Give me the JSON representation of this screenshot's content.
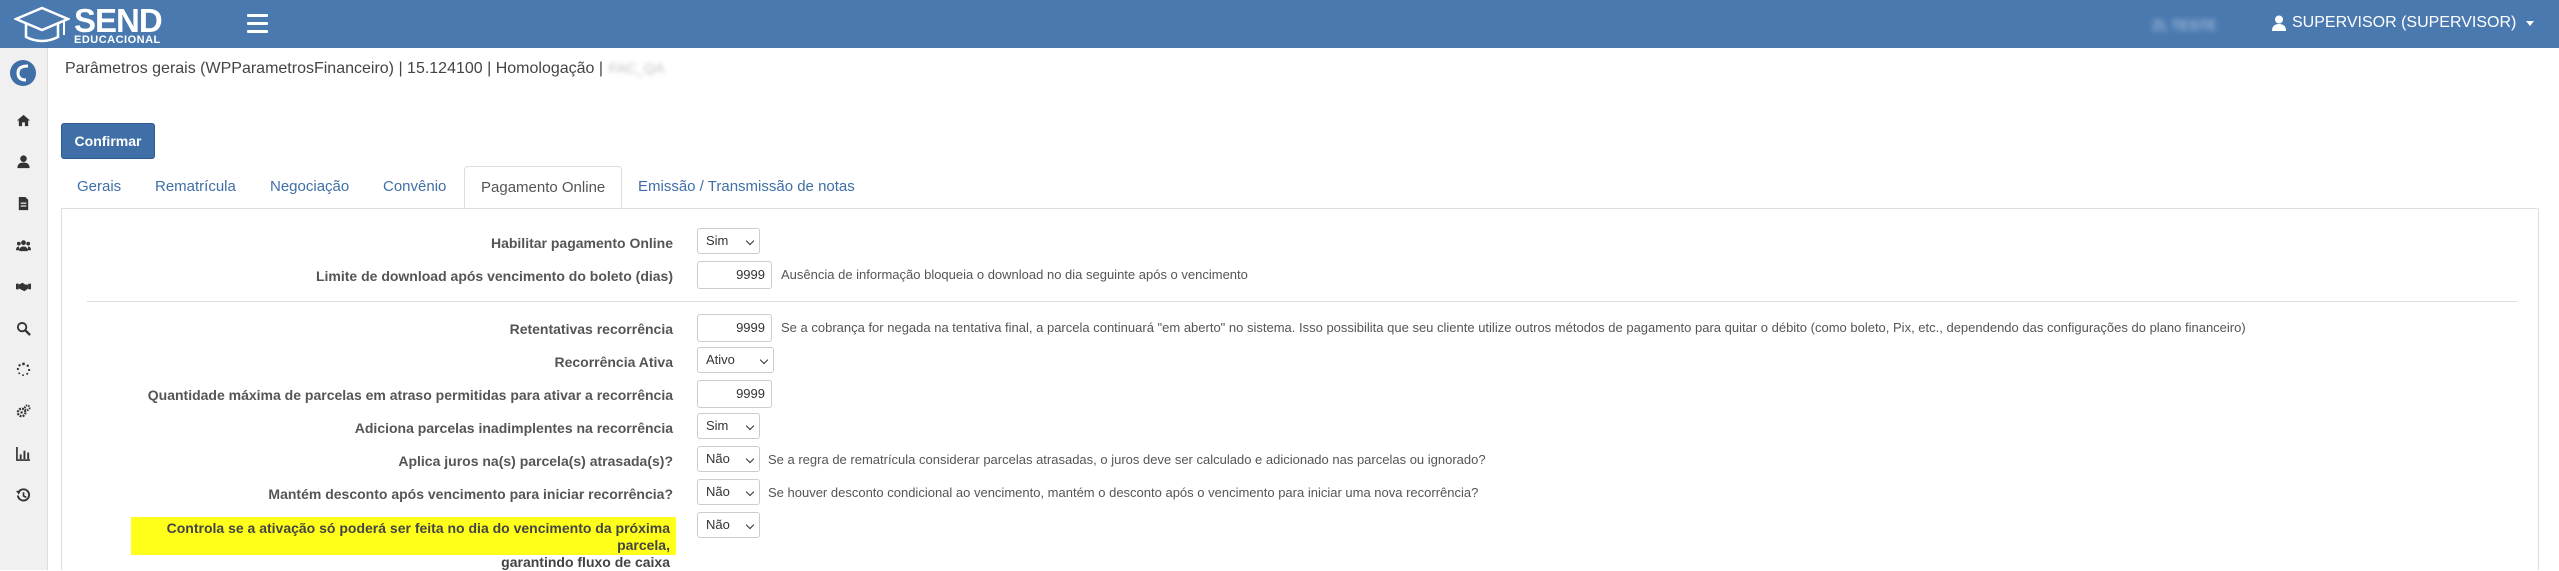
{
  "header": {
    "logo_main": "SEND",
    "logo_sub": "EDUCACIONAL",
    "blurred_context": "ZL TESTE",
    "user_label": "SUPERVISOR (SUPERVISOR)"
  },
  "page": {
    "breadcrumb": "Parâmetros gerais (WPParametrosFinanceiro) | 15.124100 | Homologação |",
    "breadcrumb_blurred": "FAC_QA",
    "confirm_label": "Confirmar"
  },
  "tabs": [
    {
      "label": "Gerais"
    },
    {
      "label": "Rematrícula"
    },
    {
      "label": "Negociação"
    },
    {
      "label": "Convênio"
    },
    {
      "label": "Pagamento Online"
    },
    {
      "label": "Emissão / Transmissão de notas"
    }
  ],
  "form": {
    "habilitar": {
      "label": "Habilitar pagamento Online",
      "value": "Sim"
    },
    "limite": {
      "label": "Limite de download após vencimento do boleto (dias)",
      "value": "9999",
      "hint": "Ausência de informação bloqueia o download no dia seguinte após o vencimento"
    },
    "retentativas": {
      "label": "Retentativas recorrência",
      "value": "9999",
      "hint": "Se a cobrança for negada na tentativa final, a parcela continuará \"em aberto\" no sistema. Isso possibilita que seu cliente utilize outros métodos de pagamento para quitar o débito (como boleto, Pix, etc., dependendo das configurações do plano financeiro)"
    },
    "recorrencia_ativa": {
      "label": "Recorrência Ativa",
      "value": "Ativo"
    },
    "qtd_max": {
      "label": "Quantidade máxima de parcelas em atraso permitidas para ativar a recorrência",
      "value": "9999"
    },
    "adiciona": {
      "label": "Adiciona parcelas inadimplentes na recorrência",
      "value": "Sim"
    },
    "juros": {
      "label": "Aplica juros na(s) parcela(s) atrasada(s)?",
      "value": "Não",
      "hint": "Se a regra de rematrícula considerar parcelas atrasadas, o juros deve ser calculado e adicionado nas parcelas ou ignorado?"
    },
    "desconto": {
      "label": "Mantém desconto após vencimento para iniciar recorrência?",
      "value": "Não",
      "hint": "Se houver desconto condicional ao vencimento, mantém o desconto após o vencimento para iniciar uma nova recorrência?"
    },
    "controla": {
      "label_line1": "Controla se a ativação só poderá ser feita no dia do vencimento da próxima parcela,",
      "label_line2": "garantindo fluxo de caixa",
      "value": "Não"
    }
  },
  "colors": {
    "topbar": "#4a79b0",
    "accent": "#3f6fa6",
    "highlight": "#ffff1a"
  }
}
